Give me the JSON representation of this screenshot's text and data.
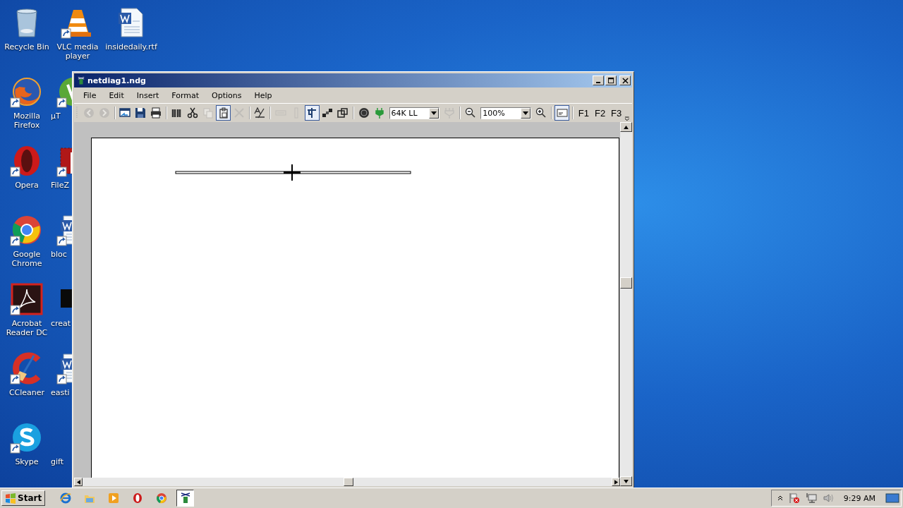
{
  "desktop_icons": [
    {
      "label": "Recycle Bin",
      "shortcut": false
    },
    {
      "label": "Mozilla Firefox",
      "shortcut": true
    },
    {
      "label": "Opera",
      "shortcut": true
    },
    {
      "label": "Google Chrome",
      "shortcut": true
    },
    {
      "label": "Acrobat Reader DC",
      "shortcut": true
    },
    {
      "label": "CCleaner",
      "shortcut": true
    },
    {
      "label": "Skype",
      "shortcut": true
    },
    {
      "label": "VLC media player",
      "shortcut": true
    },
    {
      "label": "µT",
      "shortcut": true
    },
    {
      "label": "FileZ",
      "shortcut": true
    },
    {
      "label": "bloc",
      "shortcut": true
    },
    {
      "label": "creat",
      "shortcut": false
    },
    {
      "label": "easti",
      "shortcut": true
    },
    {
      "label": "gift"
    },
    {
      "label": "insidedaily.rtf",
      "shortcut": false
    }
  ],
  "window": {
    "title": "netdiag1.ndg",
    "menu": [
      "File",
      "Edit",
      "Insert",
      "Format",
      "Options",
      "Help"
    ],
    "toolbar": [
      {
        "kind": "icon",
        "disabled": true,
        "pressed": false
      },
      {
        "kind": "icon",
        "disabled": true,
        "pressed": false
      },
      {
        "kind": "separator"
      },
      {
        "kind": "icon",
        "disabled": false,
        "pressed": false
      },
      {
        "kind": "icon",
        "disabled": false,
        "pressed": false
      },
      {
        "kind": "icon",
        "disabled": false,
        "pressed": false
      },
      {
        "kind": "separator"
      },
      {
        "kind": "icon",
        "disabled": false,
        "pressed": false
      },
      {
        "kind": "icon",
        "disabled": false,
        "pressed": false
      },
      {
        "kind": "icon",
        "disabled": true,
        "pressed": false
      },
      {
        "kind": "icon",
        "disabled": false,
        "pressed": true
      },
      {
        "kind": "icon",
        "disabled": true,
        "pressed": false
      },
      {
        "kind": "separator"
      },
      {
        "kind": "icon",
        "disabled": false,
        "pressed": false
      },
      {
        "kind": "separator"
      },
      {
        "kind": "icon",
        "disabled": true,
        "pressed": false
      },
      {
        "kind": "icon",
        "disabled": true,
        "pressed": false
      },
      {
        "kind": "icon",
        "disabled": false,
        "pressed": true
      },
      {
        "kind": "icon",
        "disabled": false,
        "pressed": false
      },
      {
        "kind": "icon",
        "disabled": false,
        "pressed": false
      },
      {
        "kind": "separator"
      },
      {
        "kind": "icon",
        "disabled": false,
        "pressed": false
      },
      {
        "kind": "icon",
        "disabled": false,
        "pressed": false
      },
      {
        "kind": "combo",
        "value": "64K LL"
      },
      {
        "kind": "icon",
        "disabled": true,
        "pressed": false
      },
      {
        "kind": "separator"
      },
      {
        "kind": "icon",
        "disabled": false,
        "pressed": false
      },
      {
        "kind": "combo",
        "value": "100%"
      },
      {
        "kind": "icon",
        "disabled": false,
        "pressed": false
      },
      {
        "kind": "separator"
      },
      {
        "kind": "icon",
        "disabled": false,
        "pressed": true
      },
      {
        "kind": "separator"
      },
      {
        "kind": "text",
        "label": "F1"
      },
      {
        "kind": "text",
        "label": "F2"
      },
      {
        "kind": "text",
        "label": "F3"
      }
    ]
  },
  "taskbar": {
    "start": "Start",
    "apps": [
      {
        "selected": false
      },
      {
        "selected": false
      },
      {
        "selected": false
      },
      {
        "selected": false
      },
      {
        "selected": false
      },
      {
        "selected": true
      }
    ],
    "clock": "9:29 AM"
  }
}
